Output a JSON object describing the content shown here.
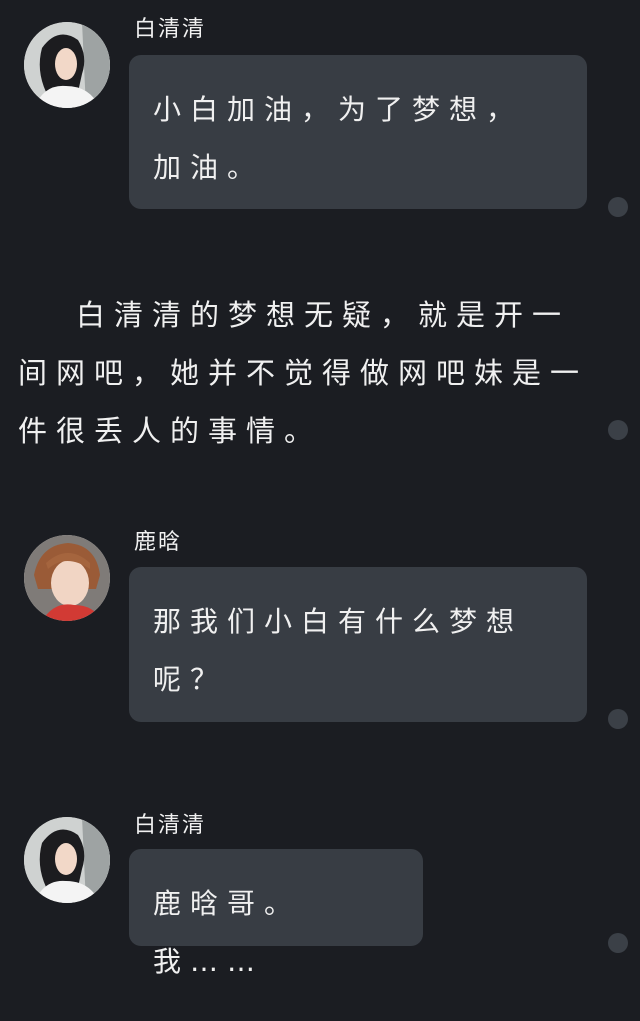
{
  "chat": {
    "messages": [
      {
        "sender": "白清清",
        "text": "小白加油，为了梦想，加油。"
      },
      {
        "sender": "鹿晗",
        "text": "那我们小白有什么梦想呢？"
      },
      {
        "sender": "白清清",
        "text": "鹿晗哥。我……"
      }
    ],
    "narration": "白清清的梦想无疑，就是开一间网吧，她并不觉得做网吧妹是一件很丢人的事情。"
  },
  "colors": {
    "background": "#1b1d22",
    "bubble": "#383d44",
    "indicator_dot": "#3b4047"
  }
}
